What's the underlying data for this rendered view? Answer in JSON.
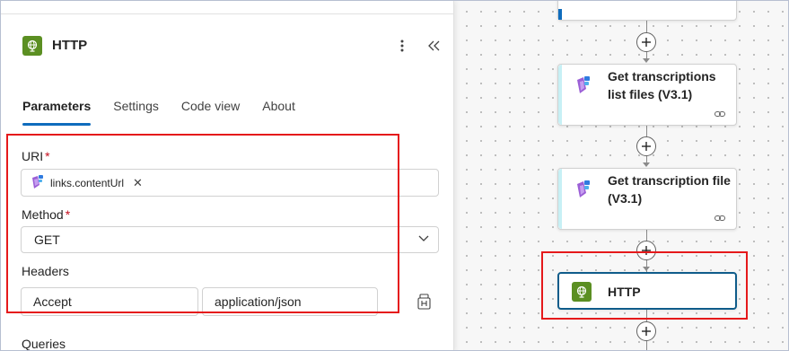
{
  "panel": {
    "title": "HTTP",
    "more_icon": "more-vertical-icon",
    "collapse_icon": "chevron-double-left-icon",
    "tabs": [
      {
        "label": "Parameters",
        "active": true
      },
      {
        "label": "Settings",
        "active": false
      },
      {
        "label": "Code view",
        "active": false
      },
      {
        "label": "About",
        "active": false
      }
    ],
    "uri": {
      "label": "URI",
      "required_mark": "*",
      "token": "links.contentUrl",
      "token_remove": "✕"
    },
    "method": {
      "label": "Method",
      "required_mark": "*",
      "value": "GET"
    },
    "headers": {
      "label": "Headers",
      "key": "Accept",
      "value": "application/json"
    },
    "queries": {
      "label": "Queries"
    }
  },
  "canvas": {
    "cards": [
      {
        "title_line1": "Get transcriptions",
        "title_line2": "list files (V3.1)"
      },
      {
        "title_line1": "Get transcription file",
        "title_line2": "(V3.1)"
      },
      {
        "title_line1": "HTTP",
        "title_line2": ""
      }
    ]
  },
  "colors": {
    "accent_blue": "#0f6cbd",
    "http_green": "#5b8f22",
    "highlight_red": "#e5191b",
    "required_red": "#c50f1f",
    "selected_card_border": "#0f5c8a"
  }
}
